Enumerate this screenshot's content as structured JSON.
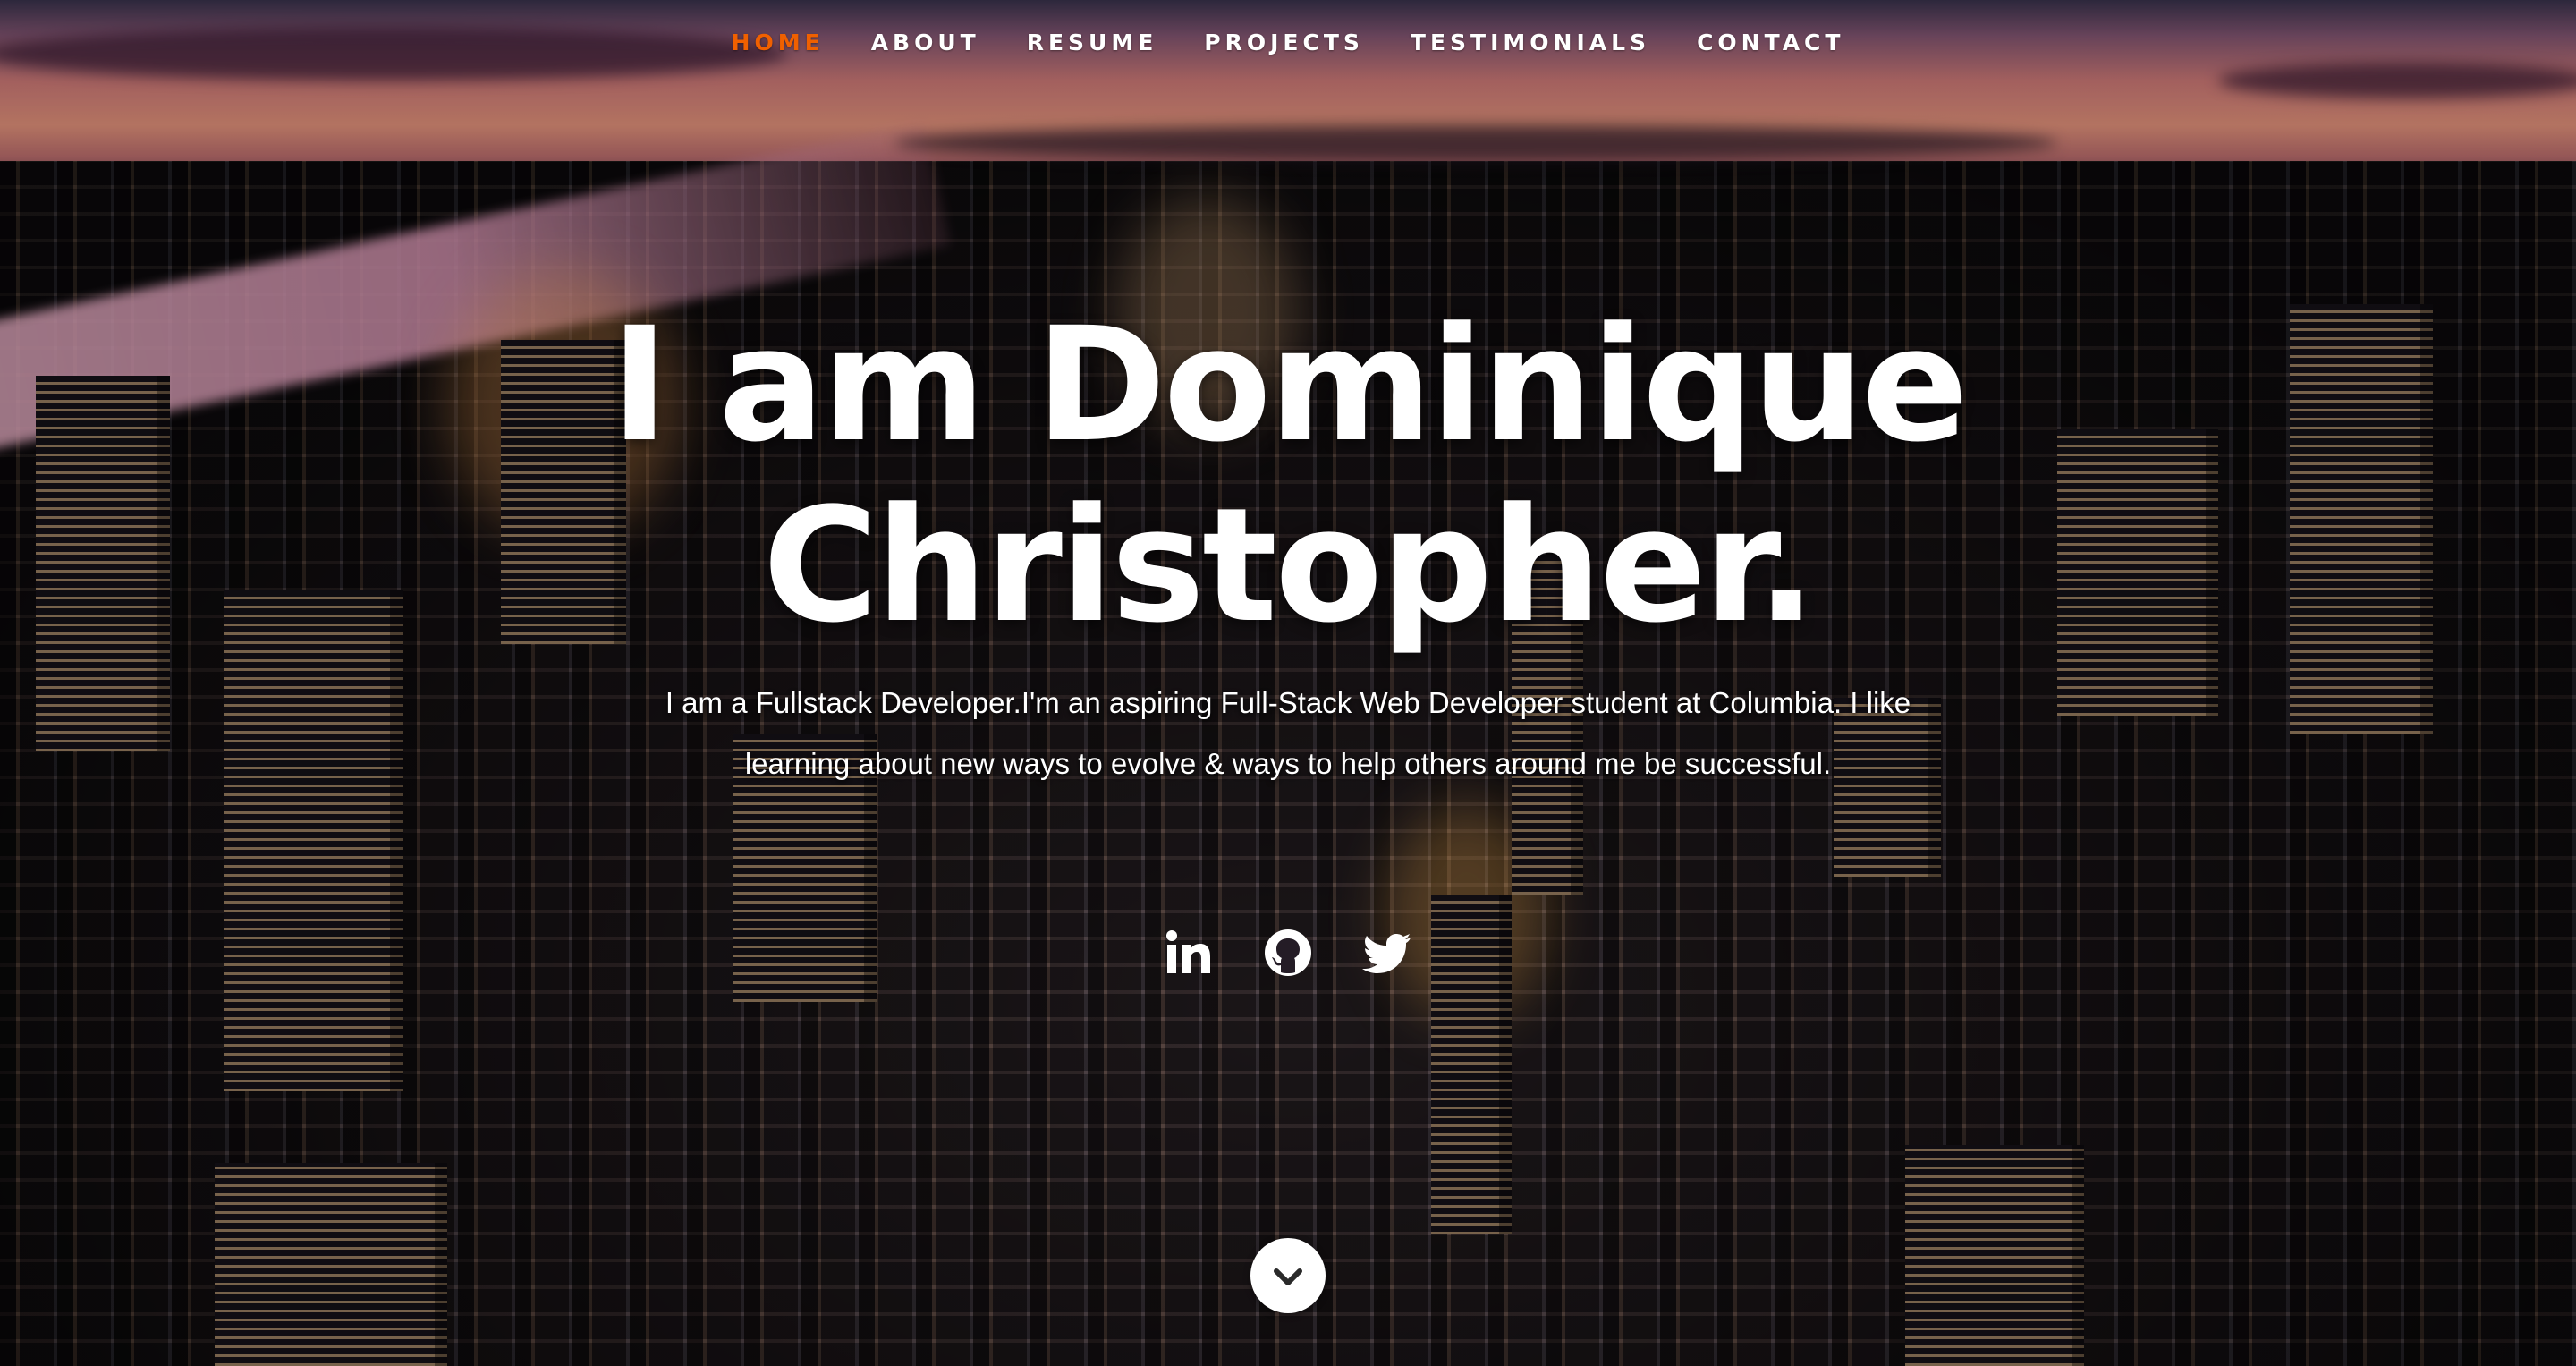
{
  "nav": {
    "items": [
      {
        "label": "HOME",
        "active": true
      },
      {
        "label": "ABOUT",
        "active": false
      },
      {
        "label": "RESUME",
        "active": false
      },
      {
        "label": "PROJECTS",
        "active": false
      },
      {
        "label": "TESTIMONIALS",
        "active": false
      },
      {
        "label": "CONTACT",
        "active": false
      }
    ],
    "active_color": "#f06000",
    "text_color": "#ffffff"
  },
  "hero": {
    "title_line1": "I am Dominique",
    "title_line2": "Christopher.",
    "description": "I am a Fullstack Developer.I'm an aspiring Full-Stack Web Developer student at Columbia. I like learning about new ways to evolve & ways to help others around me be successful."
  },
  "social": [
    {
      "icon": "linkedin-icon"
    },
    {
      "icon": "github-icon"
    },
    {
      "icon": "twitter-icon"
    }
  ],
  "scroll_button": {
    "icon": "chevron-down-icon"
  }
}
